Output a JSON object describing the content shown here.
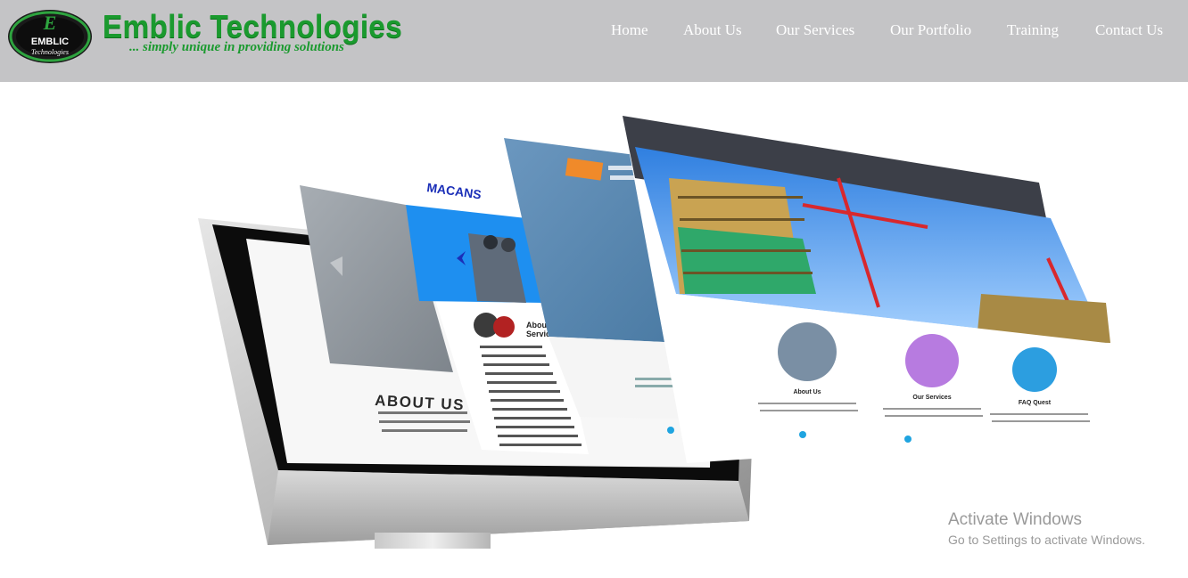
{
  "brand": {
    "badge_top": "E",
    "badge_mid": "EMBLIC",
    "badge_bottom": "Technologies",
    "name": "Emblic Technologies",
    "tagline": "... simply unique in providing solutions",
    "color": "#1a9a2e"
  },
  "nav": {
    "items": [
      {
        "label": "Home"
      },
      {
        "label": "About Us"
      },
      {
        "label": "Our Services"
      },
      {
        "label": "Our Portfolio"
      },
      {
        "label": "Training"
      },
      {
        "label": "Contact Us"
      }
    ]
  },
  "hero": {
    "screen_left": {
      "heading": "ABOUT US"
    },
    "screen_macans": {
      "logo": "MACANS",
      "heading_line1": "About S",
      "heading_line2": "Service"
    },
    "screen_front": {
      "col1": "About Us",
      "col2": "Our Services",
      "col3": "FAQ Quest"
    }
  },
  "os_notice": {
    "title": "Activate Windows",
    "subtitle": "Go to Settings to activate Windows."
  },
  "colors": {
    "header_bg": "#c4c4c6",
    "nav_text": "#ffffff",
    "macans_blue": "#1e8ff0",
    "panel_steel": "#5d8cb3",
    "front_topbar": "#3c3f48"
  }
}
